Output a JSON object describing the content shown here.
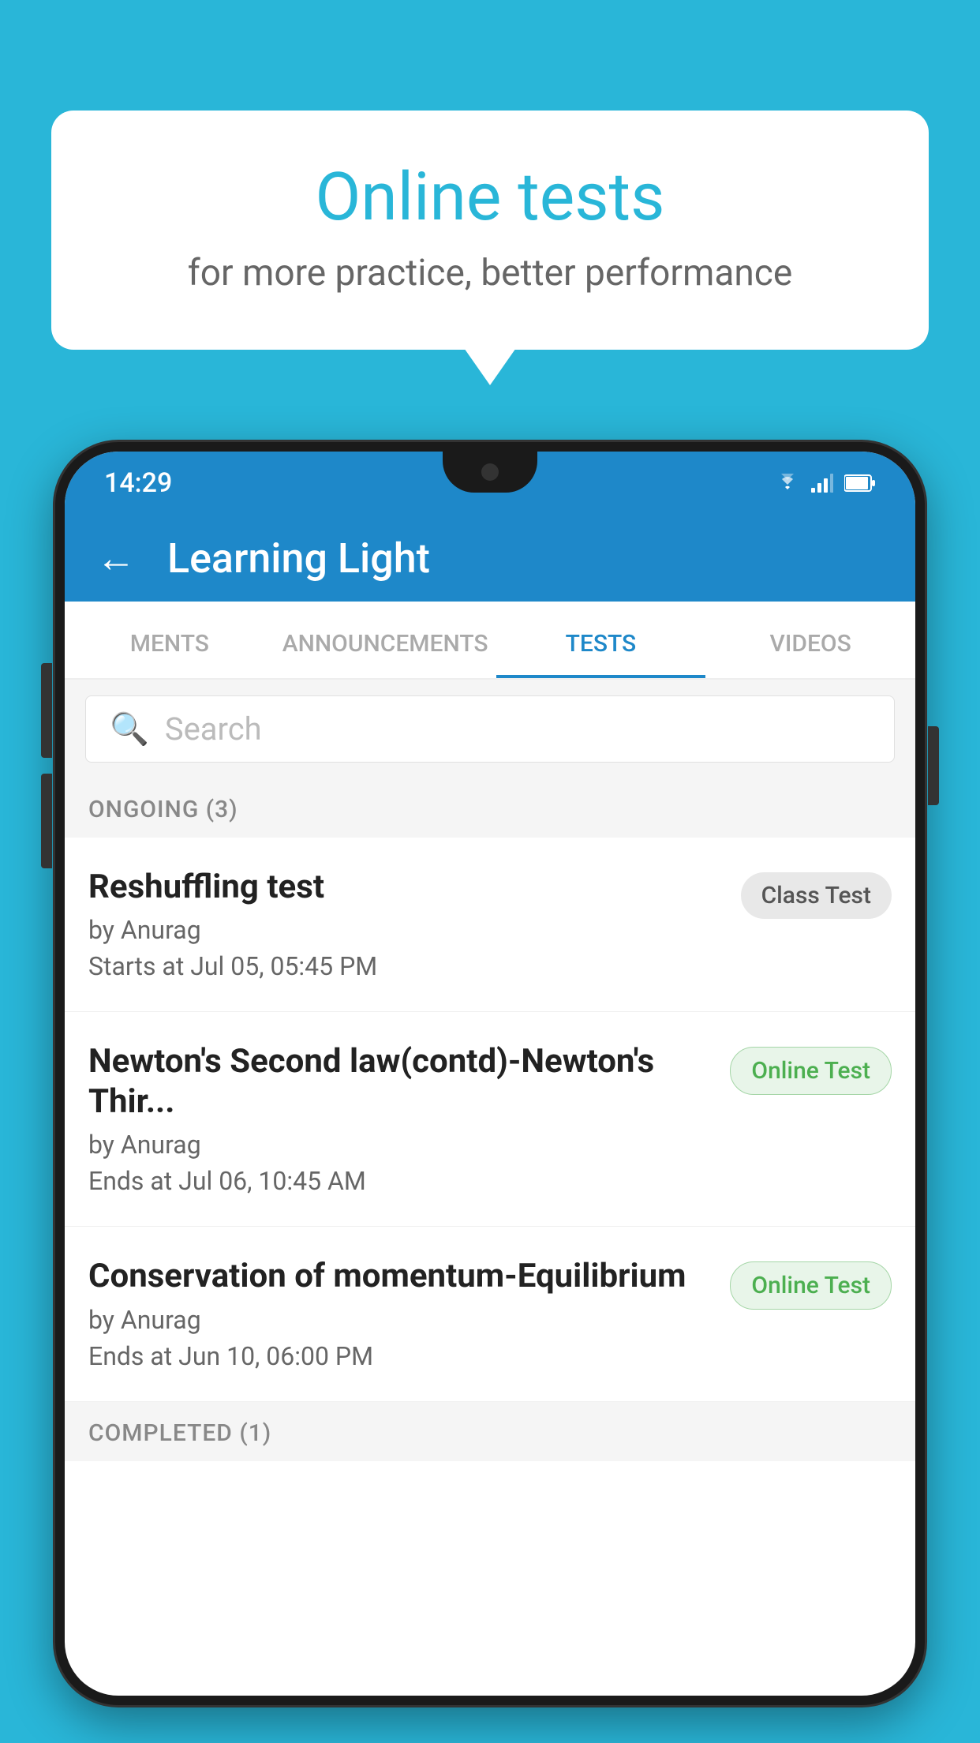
{
  "background_color": "#29b6d8",
  "speech_bubble": {
    "title": "Online tests",
    "subtitle": "for more practice, better performance"
  },
  "phone": {
    "status_bar": {
      "time": "14:29",
      "icons": [
        "wifi",
        "signal",
        "battery"
      ]
    },
    "app_header": {
      "title": "Learning Light",
      "back_label": "←"
    },
    "tabs": [
      {
        "label": "MENTS",
        "active": false
      },
      {
        "label": "ANNOUNCEMENTS",
        "active": false
      },
      {
        "label": "TESTS",
        "active": true
      },
      {
        "label": "VIDEOS",
        "active": false
      }
    ],
    "search": {
      "placeholder": "Search"
    },
    "ongoing_section": {
      "label": "ONGOING (3)"
    },
    "tests": [
      {
        "name": "Reshuffling test",
        "author": "by Anurag",
        "time_label": "Starts at",
        "time": "Jul 05, 05:45 PM",
        "badge": "Class Test",
        "badge_type": "class"
      },
      {
        "name": "Newton's Second law(contd)-Newton's Thir...",
        "author": "by Anurag",
        "time_label": "Ends at",
        "time": "Jul 06, 10:45 AM",
        "badge": "Online Test",
        "badge_type": "online"
      },
      {
        "name": "Conservation of momentum-Equilibrium",
        "author": "by Anurag",
        "time_label": "Ends at",
        "time": "Jun 10, 06:00 PM",
        "badge": "Online Test",
        "badge_type": "online"
      }
    ],
    "completed_section": {
      "label": "COMPLETED (1)"
    }
  }
}
